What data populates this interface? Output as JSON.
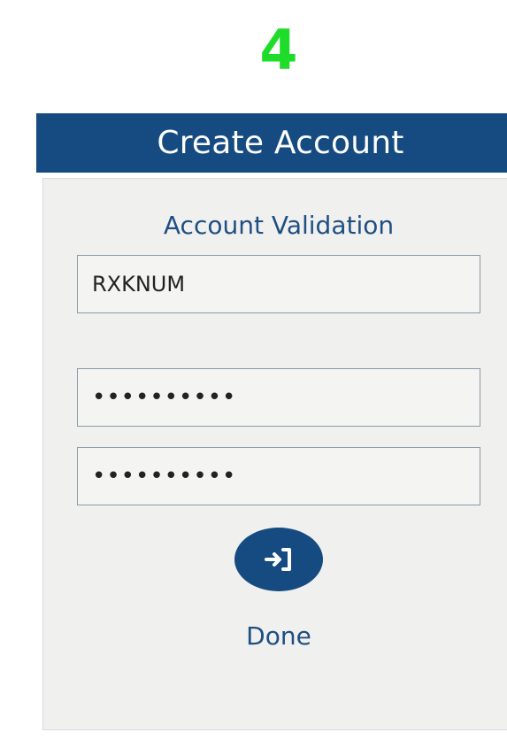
{
  "step": {
    "number": "4"
  },
  "header": {
    "title": "Create Account"
  },
  "form": {
    "section_title": "Account Validation",
    "fields": [
      {
        "value": "RXKNUM",
        "type": "text"
      },
      {
        "value": "••••••••••",
        "type": "password"
      },
      {
        "value": "••••••••••",
        "type": "password"
      }
    ],
    "submit": {
      "icon": "sign-in-icon",
      "label": "Done"
    }
  },
  "colors": {
    "step_number": "#1fdc2a",
    "header_bg": "#154b80",
    "accent_text": "#1f4f82",
    "card_bg": "#f0f0ef"
  }
}
